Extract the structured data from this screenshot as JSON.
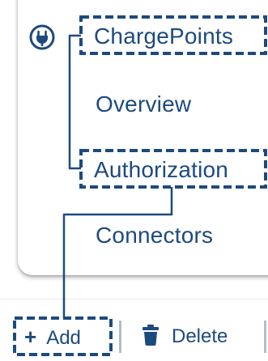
{
  "nav": {
    "items": [
      {
        "label": "ChargePoints",
        "icon": "plug-icon"
      },
      {
        "label": "Overview"
      },
      {
        "label": "Authorization"
      },
      {
        "label": "Connectors"
      }
    ]
  },
  "toolbar": {
    "add_label": "Add",
    "add_icon": "plus-icon",
    "delete_label": "Delete",
    "delete_icon": "trash-icon"
  },
  "colors": {
    "text": "#1d4a7e",
    "highlight": "#1d4a7e",
    "separator": "#b5bcc5"
  }
}
